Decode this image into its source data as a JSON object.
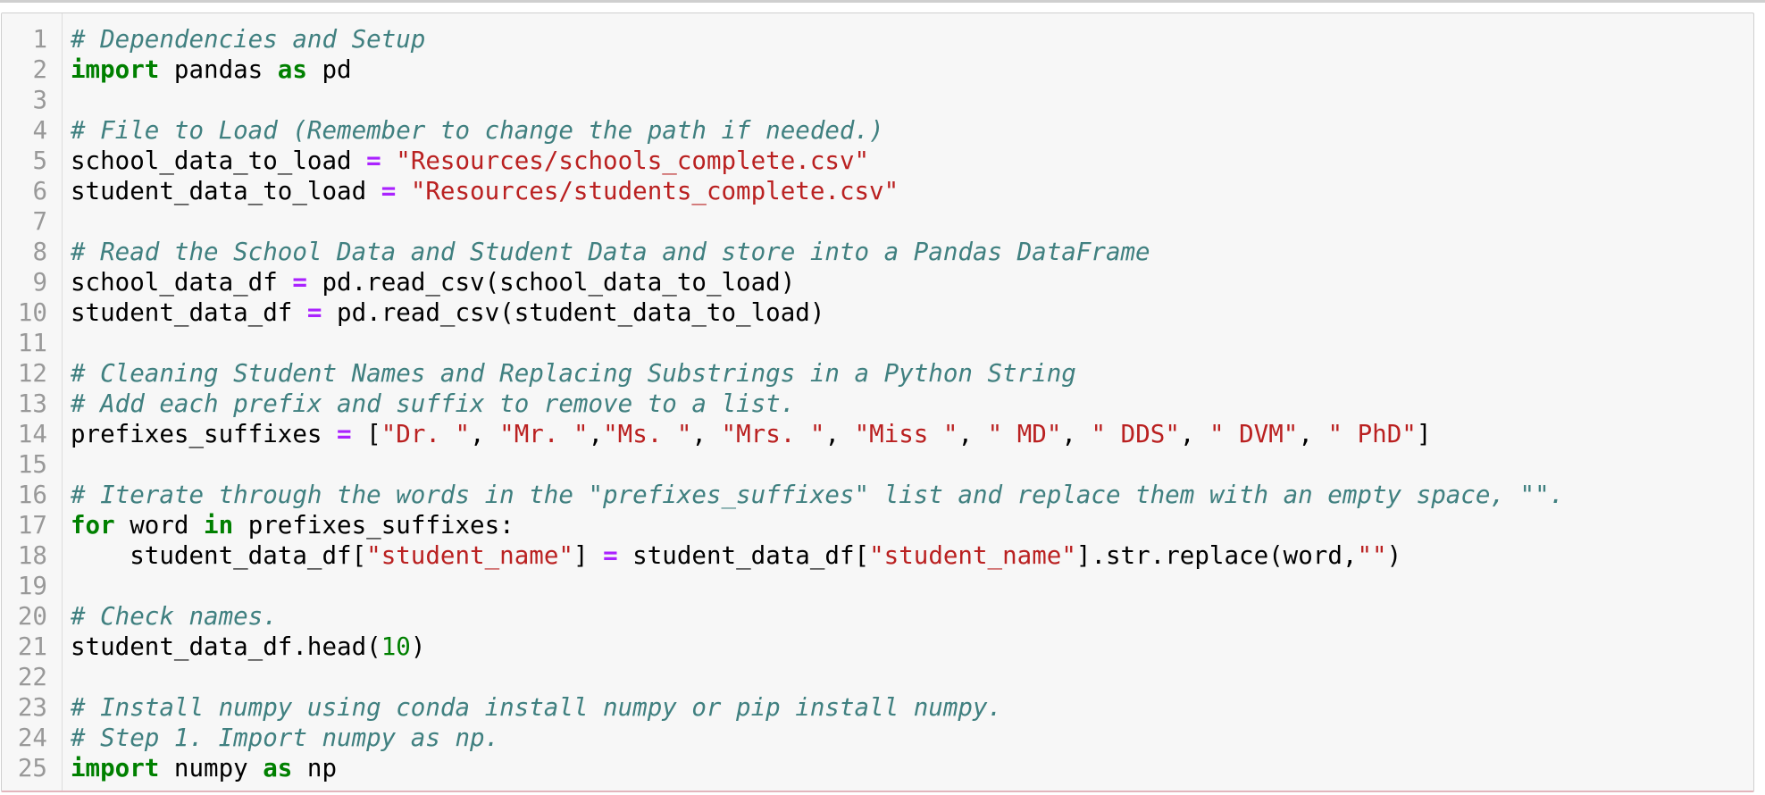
{
  "editor": {
    "language": "python",
    "colors": {
      "comment": "#408080",
      "keyword": "#008000",
      "string": "#BA2121",
      "operator": "#AA22FF",
      "number": "#008000",
      "line_number": "#999999",
      "background": "#F7F7F7"
    },
    "lines": [
      {
        "n": "1",
        "tokens": [
          {
            "t": "c",
            "v": "# Dependencies and Setup"
          }
        ]
      },
      {
        "n": "2",
        "tokens": [
          {
            "t": "k",
            "v": "import"
          },
          {
            "t": "p",
            "v": " pandas "
          },
          {
            "t": "k",
            "v": "as"
          },
          {
            "t": "p",
            "v": " pd"
          }
        ]
      },
      {
        "n": "3",
        "tokens": []
      },
      {
        "n": "4",
        "tokens": [
          {
            "t": "c",
            "v": "# File to Load (Remember to change the path if needed.)"
          }
        ]
      },
      {
        "n": "5",
        "tokens": [
          {
            "t": "p",
            "v": "school_data_to_load "
          },
          {
            "t": "o",
            "v": "="
          },
          {
            "t": "p",
            "v": " "
          },
          {
            "t": "s",
            "v": "\"Resources/schools_complete.csv\""
          }
        ]
      },
      {
        "n": "6",
        "tokens": [
          {
            "t": "p",
            "v": "student_data_to_load "
          },
          {
            "t": "o",
            "v": "="
          },
          {
            "t": "p",
            "v": " "
          },
          {
            "t": "s",
            "v": "\"Resources/students_complete.csv\""
          }
        ]
      },
      {
        "n": "7",
        "tokens": []
      },
      {
        "n": "8",
        "tokens": [
          {
            "t": "c",
            "v": "# Read the School Data and Student Data and store into a Pandas DataFrame"
          }
        ]
      },
      {
        "n": "9",
        "tokens": [
          {
            "t": "p",
            "v": "school_data_df "
          },
          {
            "t": "o",
            "v": "="
          },
          {
            "t": "p",
            "v": " pd.read_csv(school_data_to_load)"
          }
        ]
      },
      {
        "n": "10",
        "tokens": [
          {
            "t": "p",
            "v": "student_data_df "
          },
          {
            "t": "o",
            "v": "="
          },
          {
            "t": "p",
            "v": " pd.read_csv(student_data_to_load)"
          }
        ]
      },
      {
        "n": "11",
        "tokens": []
      },
      {
        "n": "12",
        "tokens": [
          {
            "t": "c",
            "v": "# Cleaning Student Names and Replacing Substrings in a Python String"
          }
        ]
      },
      {
        "n": "13",
        "tokens": [
          {
            "t": "c",
            "v": "# Add each prefix and suffix to remove to a list."
          }
        ]
      },
      {
        "n": "14",
        "tokens": [
          {
            "t": "p",
            "v": "prefixes_suffixes "
          },
          {
            "t": "o",
            "v": "="
          },
          {
            "t": "p",
            "v": " ["
          },
          {
            "t": "s",
            "v": "\"Dr. \""
          },
          {
            "t": "p",
            "v": ", "
          },
          {
            "t": "s",
            "v": "\"Mr. \""
          },
          {
            "t": "p",
            "v": ","
          },
          {
            "t": "s",
            "v": "\"Ms. \""
          },
          {
            "t": "p",
            "v": ", "
          },
          {
            "t": "s",
            "v": "\"Mrs. \""
          },
          {
            "t": "p",
            "v": ", "
          },
          {
            "t": "s",
            "v": "\"Miss \""
          },
          {
            "t": "p",
            "v": ", "
          },
          {
            "t": "s",
            "v": "\" MD\""
          },
          {
            "t": "p",
            "v": ", "
          },
          {
            "t": "s",
            "v": "\" DDS\""
          },
          {
            "t": "p",
            "v": ", "
          },
          {
            "t": "s",
            "v": "\" DVM\""
          },
          {
            "t": "p",
            "v": ", "
          },
          {
            "t": "s",
            "v": "\" PhD\""
          },
          {
            "t": "p",
            "v": "]"
          }
        ]
      },
      {
        "n": "15",
        "tokens": []
      },
      {
        "n": "16",
        "tokens": [
          {
            "t": "c",
            "v": "# Iterate through the words in the \"prefixes_suffixes\" list and replace them with an empty space, \"\"."
          }
        ]
      },
      {
        "n": "17",
        "tokens": [
          {
            "t": "k",
            "v": "for"
          },
          {
            "t": "p",
            "v": " word "
          },
          {
            "t": "k",
            "v": "in"
          },
          {
            "t": "p",
            "v": " prefixes_suffixes:"
          }
        ]
      },
      {
        "n": "18",
        "tokens": [
          {
            "t": "p",
            "v": "    student_data_df["
          },
          {
            "t": "s",
            "v": "\"student_name\""
          },
          {
            "t": "p",
            "v": "] "
          },
          {
            "t": "o",
            "v": "="
          },
          {
            "t": "p",
            "v": " student_data_df["
          },
          {
            "t": "s",
            "v": "\"student_name\""
          },
          {
            "t": "p",
            "v": "].str.replace(word,"
          },
          {
            "t": "s",
            "v": "\"\""
          },
          {
            "t": "p",
            "v": ")"
          }
        ]
      },
      {
        "n": "19",
        "tokens": []
      },
      {
        "n": "20",
        "tokens": [
          {
            "t": "c",
            "v": "# Check names."
          }
        ]
      },
      {
        "n": "21",
        "tokens": [
          {
            "t": "p",
            "v": "student_data_df.head("
          },
          {
            "t": "n",
            "v": "10"
          },
          {
            "t": "p",
            "v": ")"
          }
        ]
      },
      {
        "n": "22",
        "tokens": []
      },
      {
        "n": "23",
        "tokens": [
          {
            "t": "c",
            "v": "# Install numpy using conda install numpy or pip install numpy."
          }
        ]
      },
      {
        "n": "24",
        "tokens": [
          {
            "t": "c",
            "v": "# Step 1. Import numpy as np."
          }
        ]
      },
      {
        "n": "25",
        "tokens": [
          {
            "t": "k",
            "v": "import"
          },
          {
            "t": "p",
            "v": " numpy "
          },
          {
            "t": "k",
            "v": "as"
          },
          {
            "t": "p",
            "v": " np"
          }
        ]
      }
    ]
  }
}
